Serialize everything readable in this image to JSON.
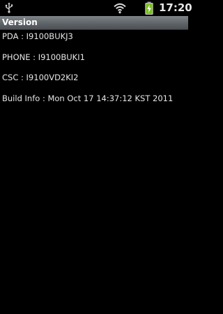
{
  "status_bar": {
    "time": "17:20",
    "icons": [
      "usb-icon",
      "wifi-icon",
      "battery-charging-icon"
    ],
    "battery_color": "#8fd12e"
  },
  "title_bar": {
    "title": "Version"
  },
  "info": {
    "pda": "PDA : I9100BUKJ3",
    "phone": "PHONE : I9100BUKI1",
    "csc": "CSC : I9100VD2KI2",
    "build": "Build Info : Mon Oct 17 14:37:12 KST 2011"
  }
}
